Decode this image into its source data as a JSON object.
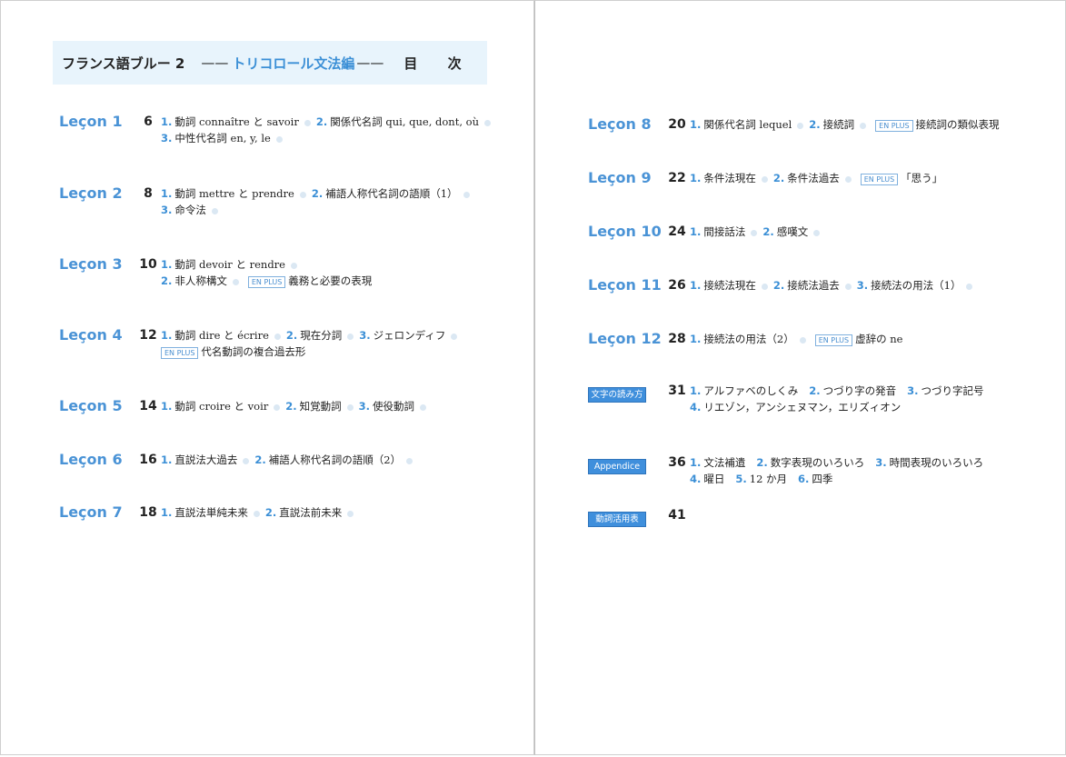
{
  "header": {
    "title": "フランス語ブルー 2",
    "dash": "——",
    "subtitle": "トリコロール文法編",
    "dash2": "——",
    "contents": "目 次"
  },
  "en_plus_label": "EN PLUS",
  "left_lessons": [
    {
      "label": "Leçon 1",
      "page": "6",
      "line1": [
        {
          "n": "1.",
          "t": "動詞 connaître と savoir"
        },
        {
          "n": "2.",
          "t": "関係代名詞 qui, que, dont, où"
        }
      ],
      "line2": [
        {
          "n": "3.",
          "t": "中性代名詞 en, y, le"
        }
      ]
    },
    {
      "label": "Leçon 2",
      "page": "8",
      "line1": [
        {
          "n": "1.",
          "t": "動詞 mettre と prendre"
        },
        {
          "n": "2.",
          "t": "補語人称代名詞の語順（1）"
        }
      ],
      "line2": [
        {
          "n": "3.",
          "t": "命令法"
        }
      ]
    },
    {
      "label": "Leçon 3",
      "page": "10",
      "line1": [
        {
          "n": "1.",
          "t": "動詞 devoir と rendre"
        }
      ],
      "line2": [
        {
          "n": "2.",
          "t": "非人称構文"
        }
      ],
      "line2_enplus": "義務と必要の表現"
    },
    {
      "label": "Leçon 4",
      "page": "12",
      "line1": [
        {
          "n": "1.",
          "t": "動詞 dire と écrire"
        },
        {
          "n": "2.",
          "t": "現在分詞"
        },
        {
          "n": "3.",
          "t": "ジェロンディフ"
        }
      ],
      "line2_enplus_only": "代名動詞の複合過去形"
    },
    {
      "label": "Leçon 5",
      "page": "14",
      "line1": [
        {
          "n": "1.",
          "t": "動詞 croire と voir"
        },
        {
          "n": "2.",
          "t": "知覚動詞"
        },
        {
          "n": "3.",
          "t": "使役動詞"
        }
      ]
    },
    {
      "label": "Leçon 6",
      "page": "16",
      "line1": [
        {
          "n": "1.",
          "t": "直説法大過去"
        },
        {
          "n": "2.",
          "t": "補語人称代名詞の語順（2）"
        }
      ]
    },
    {
      "label": "Leçon 7",
      "page": "18",
      "line1": [
        {
          "n": "1.",
          "t": "直説法単純未来"
        },
        {
          "n": "2.",
          "t": "直説法前未来"
        }
      ]
    }
  ],
  "right_lessons": [
    {
      "label": "Leçon 8",
      "page": "20",
      "line1": [
        {
          "n": "1.",
          "t": "関係代名詞 lequel"
        },
        {
          "n": "2.",
          "t": "接続詞"
        }
      ],
      "enplus": "接続詞の類似表現"
    },
    {
      "label": "Leçon 9",
      "page": "22",
      "line1": [
        {
          "n": "1.",
          "t": "条件法現在"
        },
        {
          "n": "2.",
          "t": "条件法過去"
        }
      ],
      "enplus": "「思う」"
    },
    {
      "label": "Leçon 10",
      "page": "24",
      "line1": [
        {
          "n": "1.",
          "t": "間接話法"
        },
        {
          "n": "2.",
          "t": "感嘆文"
        }
      ]
    },
    {
      "label": "Leçon 11",
      "page": "26",
      "line1": [
        {
          "n": "1.",
          "t": "接続法現在"
        },
        {
          "n": "2.",
          "t": "接続法過去"
        },
        {
          "n": "3.",
          "t": "接続法の用法（1）"
        }
      ]
    },
    {
      "label": "Leçon 12",
      "page": "28",
      "line1": [
        {
          "n": "1.",
          "t": "接続法の用法（2）"
        }
      ],
      "enplus": "虚辞の ne"
    }
  ],
  "extras": [
    {
      "badge": "文字の読み方",
      "page": "31",
      "line1": [
        {
          "n": "1.",
          "t": "アルファベのしくみ"
        },
        {
          "n": "2.",
          "t": "つづり字の発音"
        },
        {
          "n": "3.",
          "t": "つづり字記号"
        }
      ],
      "line2": [
        {
          "n": "4.",
          "t": "リエゾン，アンシェヌマン，エリズィオン"
        }
      ]
    },
    {
      "badge": "Appendice",
      "page": "36",
      "line1": [
        {
          "n": "1.",
          "t": "文法補遺"
        },
        {
          "n": "2.",
          "t": "数字表現のいろいろ"
        },
        {
          "n": "3.",
          "t": "時間表現のいろいろ"
        }
      ],
      "line2": [
        {
          "n": "4.",
          "t": "曜日"
        },
        {
          "n": "5.",
          "t": "12 か月"
        },
        {
          "n": "6.",
          "t": "四季"
        }
      ]
    },
    {
      "badge": "動詞活用表",
      "page": "41"
    }
  ]
}
